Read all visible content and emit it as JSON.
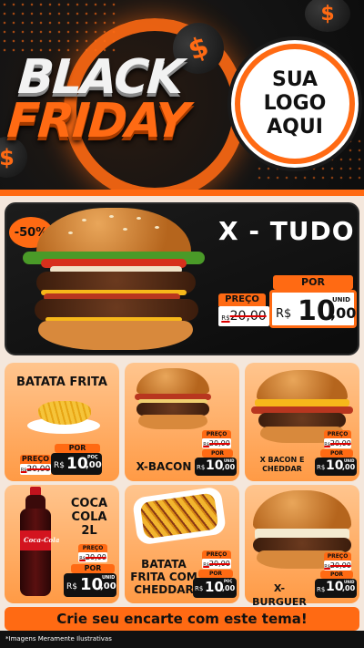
{
  "header": {
    "title_line1": "BLACK",
    "title_line2": "FRIDAY",
    "logo_line1": "SUA",
    "logo_line2": "LOGO",
    "logo_line3": "AQUI",
    "coin_symbol": "$"
  },
  "featured": {
    "name": "X - TUDO",
    "discount": "-50%",
    "price_label": "PREÇO",
    "old_currency": "R$",
    "old_price": "20,00",
    "por_label": "POR",
    "currency": "R$",
    "price_int": "10",
    "price_dec": ",00",
    "unit": "UNID"
  },
  "products": [
    {
      "name": "BATATA FRITA",
      "price_label": "PREÇO",
      "old_currency": "R$",
      "old_price": "20,00",
      "por_label": "POR",
      "currency": "R$",
      "price_int": "10",
      "price_dec": ",00",
      "unit": "POÇ"
    },
    {
      "name": "X-BACON",
      "price_label": "PREÇO",
      "old_currency": "R$",
      "old_price": "20,00",
      "por_label": "POR",
      "currency": "R$",
      "price_int": "10",
      "price_dec": ",00",
      "unit": "UNID"
    },
    {
      "name": "X BACON E CHEDDAR",
      "price_label": "PREÇO",
      "old_currency": "R$",
      "old_price": "20,00",
      "por_label": "POR",
      "currency": "R$",
      "price_int": "10",
      "price_dec": ",00",
      "unit": "UNID"
    },
    {
      "name_line1": "COCA",
      "name_line2": "COLA",
      "name_line3": "2L",
      "price_label": "PREÇO",
      "old_currency": "R$",
      "old_price": "20,00",
      "por_label": "POR",
      "currency": "R$",
      "price_int": "10",
      "price_dec": ",00",
      "unit": "UNID"
    },
    {
      "name_line1": "BATATA",
      "name_line2": "FRITA COM",
      "name_line3": "CHEDDAR",
      "price_label": "PREÇO",
      "old_currency": "R$",
      "old_price": "20,00",
      "por_label": "POR",
      "currency": "R$",
      "price_int": "10",
      "price_dec": ",00",
      "unit": "POÇ"
    },
    {
      "name": "X-BURGUER",
      "price_label": "PREÇO",
      "old_currency": "R$",
      "old_price": "20,00",
      "por_label": "POR",
      "currency": "R$",
      "price_int": "10",
      "price_dec": ",00",
      "unit": "UNID"
    }
  ],
  "footer": {
    "cta": "Crie seu encarte com este tema!",
    "note": "*Imagens Meramente Ilustrativas"
  },
  "colors": {
    "accent": "#ff6a13",
    "dark": "#111111",
    "card": "#ffb06a"
  }
}
